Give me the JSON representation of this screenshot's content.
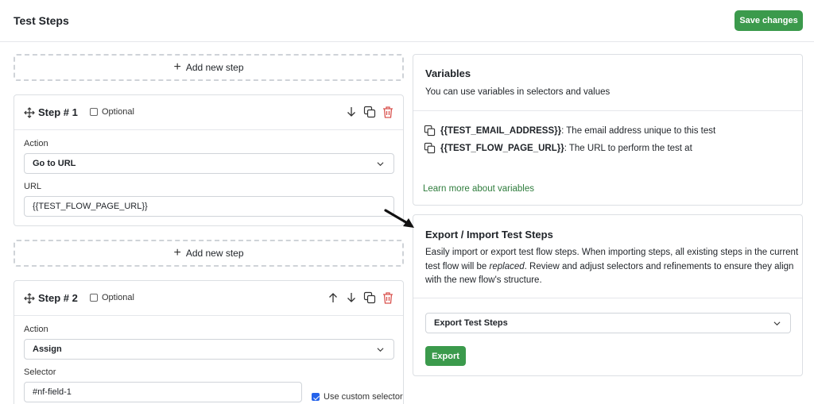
{
  "header": {
    "title": "Test Steps",
    "save_label": "Save changes"
  },
  "add_step_label": "Add new step",
  "steps": [
    {
      "title": "Step # 1",
      "optional_label": "Optional",
      "action_label": "Action",
      "action_value": "Go to URL",
      "url_label": "URL",
      "url_value": "{{TEST_FLOW_PAGE_URL}}"
    },
    {
      "title": "Step # 2",
      "optional_label": "Optional",
      "action_label": "Action",
      "action_value": "Assign",
      "selector_label": "Selector",
      "selector_value": "#nf-field-1",
      "custom_selector_label": "Use custom selector",
      "custom_selector_checked": true
    }
  ],
  "variables": {
    "title": "Variables",
    "description": "You can use variables in selectors and values",
    "items": [
      {
        "name": "{{TEST_EMAIL_ADDRESS}}",
        "desc": ": The email address unique to this test"
      },
      {
        "name": "{{TEST_FLOW_PAGE_URL}}",
        "desc": ": The URL to perform the test at"
      }
    ],
    "learn_more": "Learn more about variables"
  },
  "export_import": {
    "title": "Export / Import Test Steps",
    "line1": "Easily import or export test flow steps. When importing steps, all existing steps in the current",
    "line2_pre": "test flow will be ",
    "line2_em": "replaced",
    "line2_post": ". Review and adjust selectors and refinements to ensure they align",
    "line3": "with the new flow's structure.",
    "select_value": "Export Test Steps",
    "button_label": "Export"
  },
  "colors": {
    "primary_green": "#3b9a4c",
    "link_green": "#2f7d3d",
    "delete_red": "#d9534f"
  }
}
